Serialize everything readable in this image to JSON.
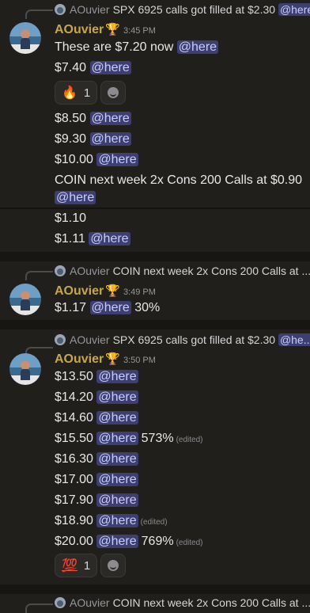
{
  "author": "AOuvier",
  "groups": [
    {
      "reply": {
        "author": "AOuvier",
        "text": "SPX 6925 calls got filled at $2.30",
        "mention": "@here..."
      },
      "time": "3:45 PM",
      "lines": [
        {
          "text": "These are $7.20 now",
          "mention": "@here"
        },
        {
          "text": "$7.40",
          "mention": "@here"
        }
      ],
      "reaction": {
        "emoji": "🔥",
        "count": "1"
      },
      "lines2": [
        {
          "text": "$8.50",
          "mention": "@here"
        },
        {
          "text": "$9.30",
          "mention": "@here"
        },
        {
          "text": "$10.00",
          "mention": "@here"
        },
        {
          "text": "COIN next week 2x Cons 200 Calls at $0.90"
        },
        {
          "text": "",
          "mention": "@here"
        },
        {
          "text": "$1.10"
        },
        {
          "text": "$1.11",
          "mention": "@here"
        }
      ]
    },
    {
      "reply": {
        "author": "AOuvier",
        "text": "COIN next week 2x Cons 200 Calls at ..."
      },
      "time": "3:49 PM",
      "lines": [
        {
          "text": "$1.17",
          "mention": "@here",
          "suffix": "30%"
        }
      ]
    },
    {
      "reply": {
        "author": "AOuvier",
        "text": "SPX 6925 calls got filled at $2.30",
        "mention": "@he..."
      },
      "time": "3:50 PM",
      "lines": [
        {
          "text": "$13.50",
          "mention": "@here"
        },
        {
          "text": "$14.20",
          "mention": "@here"
        },
        {
          "text": "$14.60",
          "mention": "@here"
        },
        {
          "text": "$15.50",
          "mention": "@here",
          "suffix": "573%",
          "edited": "(edited)"
        },
        {
          "text": "$16.30",
          "mention": "@here"
        },
        {
          "text": "$17.00",
          "mention": "@here"
        },
        {
          "text": "$17.90",
          "mention": "@here"
        },
        {
          "text": "$18.90",
          "mention": "@here",
          "edited": "(edited)"
        },
        {
          "text": "$20.00",
          "mention": "@here",
          "suffix": "769%",
          "edited": "(edited)"
        }
      ],
      "reaction": {
        "emoji": "💯",
        "count": "1"
      }
    },
    {
      "reply": {
        "author": "AOuvier",
        "text": "COIN next week 2x Cons 200 Calls at ..."
      }
    }
  ]
}
